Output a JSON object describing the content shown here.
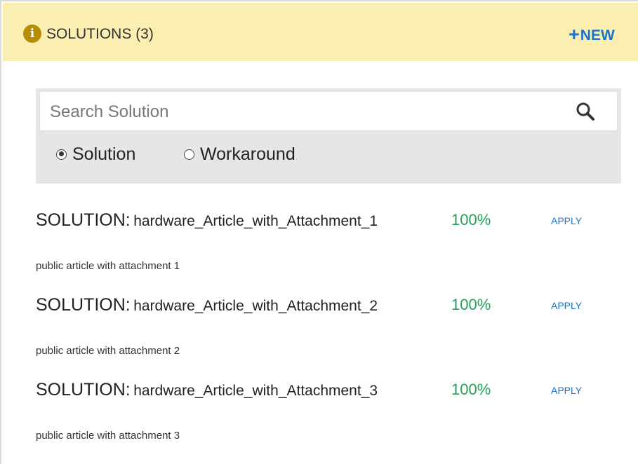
{
  "header": {
    "title": "SOLUTIONS (3)",
    "info_icon": "info-icon",
    "new_label": "NEW",
    "new_icon": "+",
    "background_color": "#fbeeb1",
    "accent_color": "#1a73c9"
  },
  "search": {
    "placeholder": "Search Solution",
    "value": "",
    "icon": "search-icon",
    "options": [
      {
        "label": "Solution",
        "checked": true
      },
      {
        "label": "Workaround",
        "checked": false
      }
    ]
  },
  "results": [
    {
      "prefix": "SOLUTION:",
      "name": "hardware_Article_with_Attachment_1",
      "description": "public article with attachment 1",
      "match": "100%",
      "action": "APPLY"
    },
    {
      "prefix": "SOLUTION:",
      "name": "hardware_Article_with_Attachment_2",
      "description": "public article with attachment 2",
      "match": "100%",
      "action": "APPLY"
    },
    {
      "prefix": "SOLUTION:",
      "name": "hardware_Article_with_Attachment_3",
      "description": "public article with attachment 3",
      "match": "100%",
      "action": "APPLY"
    }
  ],
  "colors": {
    "match": "#25a05a",
    "link": "#1a73c9"
  }
}
